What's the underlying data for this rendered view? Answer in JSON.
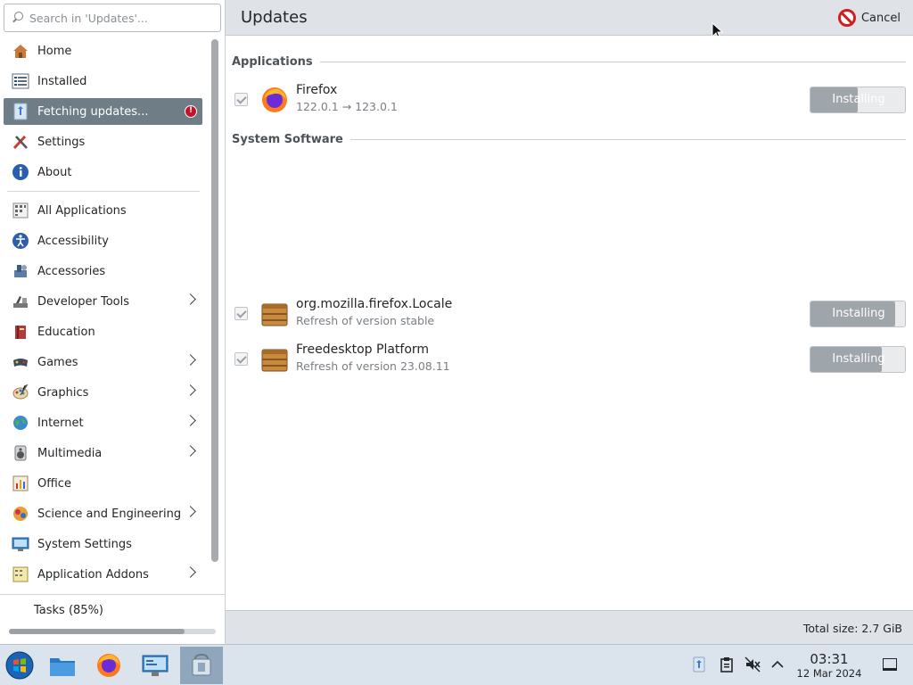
{
  "search": {
    "placeholder": "Search in 'Updates'..."
  },
  "sidebar": {
    "top_items": [
      {
        "label": "Home",
        "icon": "home-icon"
      },
      {
        "label": "Installed",
        "icon": "list-icon"
      },
      {
        "label": "Fetching updates...",
        "icon": "update-icon",
        "active": true,
        "badge": "!"
      },
      {
        "label": "Settings",
        "icon": "settings-icon"
      },
      {
        "label": "About",
        "icon": "info-icon"
      }
    ],
    "categories": [
      {
        "label": "All Applications",
        "has_children": false
      },
      {
        "label": "Accessibility",
        "has_children": false
      },
      {
        "label": "Accessories",
        "has_children": false
      },
      {
        "label": "Developer Tools",
        "has_children": true
      },
      {
        "label": "Education",
        "has_children": false
      },
      {
        "label": "Games",
        "has_children": true
      },
      {
        "label": "Graphics",
        "has_children": true
      },
      {
        "label": "Internet",
        "has_children": true
      },
      {
        "label": "Multimedia",
        "has_children": true
      },
      {
        "label": "Office",
        "has_children": false
      },
      {
        "label": "Science and Engineering",
        "has_children": true
      },
      {
        "label": "System Settings",
        "has_children": false
      },
      {
        "label": "Application Addons",
        "has_children": true
      }
    ],
    "tasks_label": "Tasks (85%)",
    "tasks_progress": 0.85
  },
  "header": {
    "title": "Updates",
    "cancel_label": "Cancel"
  },
  "sections": {
    "applications": "Applications",
    "system": "System Software"
  },
  "updates": [
    {
      "name": "Firefox",
      "version": "122.0.1 → 123.0.1",
      "status": "Installing",
      "progress": 0.5
    },
    {
      "name": "org.mozilla.firefox.Locale",
      "version": "Refresh of version stable",
      "status": "Installing",
      "progress": 0.9
    },
    {
      "name": "Freedesktop Platform",
      "version": "Refresh of version 23.08.11",
      "status": "Installing",
      "progress": 0.75
    }
  ],
  "footer": {
    "total": "Total size: 2.7 GiB"
  },
  "taskbar": {
    "time": "03:31",
    "date": "12 Mar 2024"
  },
  "colors": {
    "accent": "#6f7d87",
    "danger": "#d11f1f",
    "header_bg": "#dfe3e8"
  }
}
